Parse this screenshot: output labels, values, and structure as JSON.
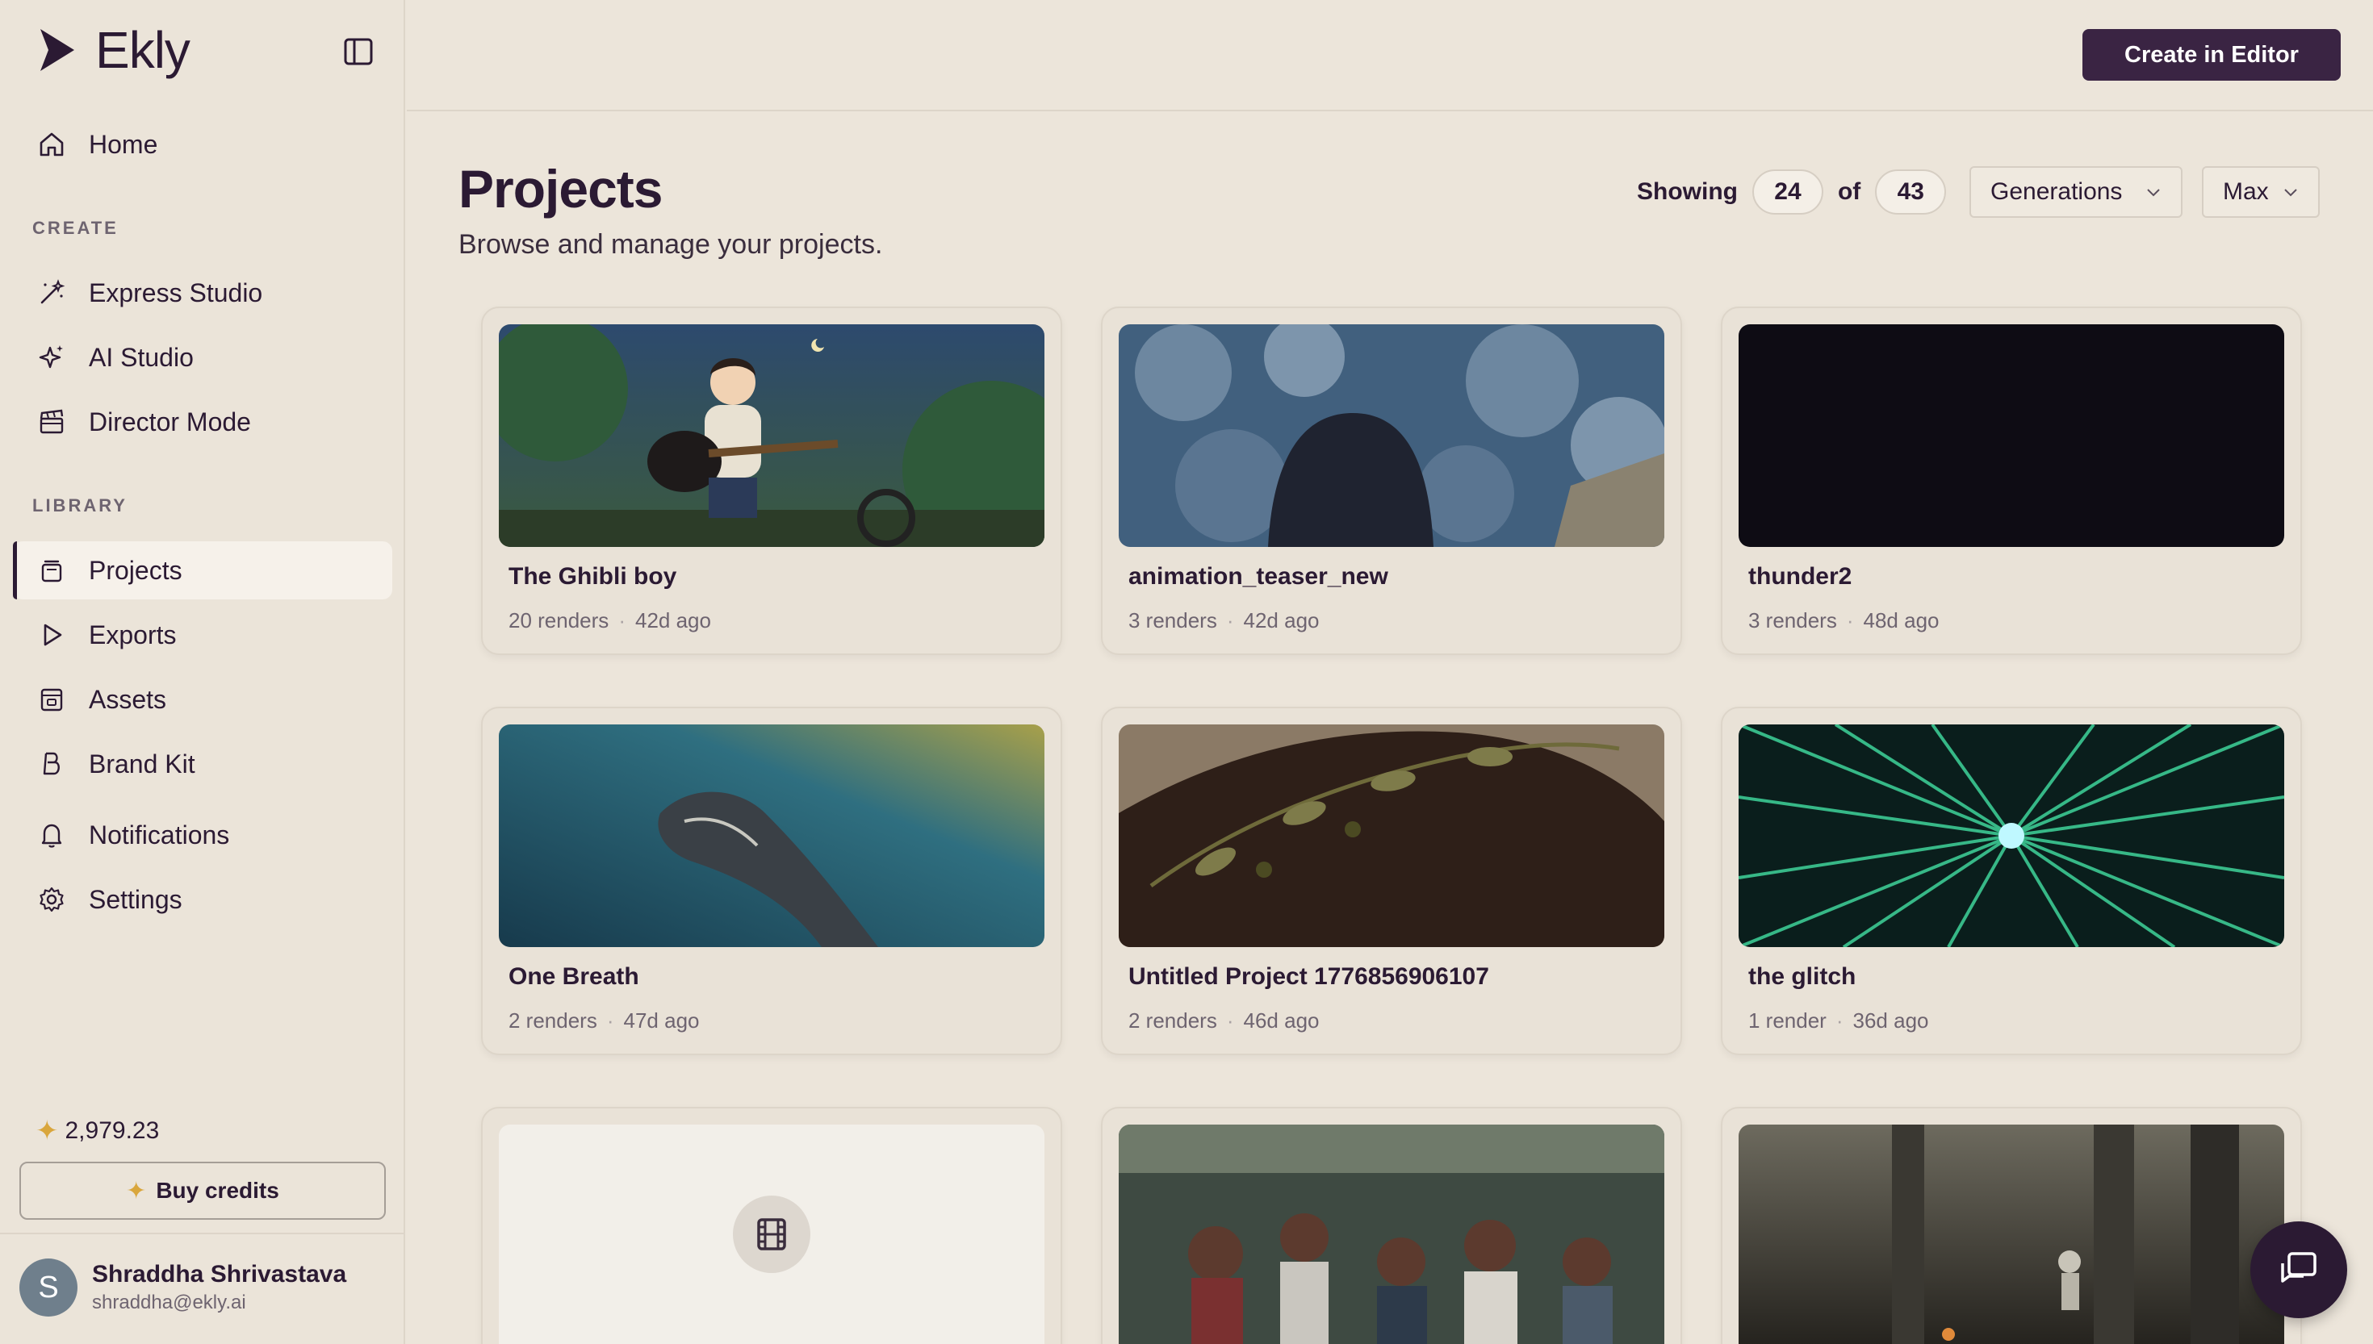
{
  "brand": {
    "name": "Ekly"
  },
  "sidebar": {
    "home": "Home",
    "create_label": "CREATE",
    "create_items": [
      "Express Studio",
      "AI Studio",
      "Director Mode"
    ],
    "library_label": "LIBRARY",
    "library_items": [
      "Projects",
      "Exports",
      "Assets",
      "Brand Kit"
    ],
    "notifications": "Notifications",
    "settings": "Settings",
    "credits": "2,979.23",
    "buy_credits": "Buy credits",
    "user": {
      "initial": "S",
      "name": "Shraddha Shrivastava",
      "email": "shraddha@ekly.ai"
    }
  },
  "topbar": {
    "create_label": "Create in Editor"
  },
  "main": {
    "title": "Projects",
    "subtitle": "Browse and manage your projects.",
    "showing_label": "Showing",
    "showing_count": "24",
    "of_label": "of",
    "total": "43",
    "filter_value": "Generations",
    "sort_value": "Max"
  },
  "projects": [
    {
      "title": "The Ghibli boy",
      "renders": "20 renders",
      "age": "42d ago"
    },
    {
      "title": "animation_teaser_new",
      "renders": "3 renders",
      "age": "42d ago"
    },
    {
      "title": "thunder2",
      "renders": "3 renders",
      "age": "48d ago"
    },
    {
      "title": "One Breath",
      "renders": "2 renders",
      "age": "47d ago"
    },
    {
      "title": "Untitled Project 1776856906107",
      "renders": "2 renders",
      "age": "46d ago"
    },
    {
      "title": "the glitch",
      "renders": "1 render",
      "age": "36d ago"
    }
  ],
  "colors": {
    "accent": "#3a2443",
    "credit_star": "#d9a63c",
    "background": "#ece5da"
  }
}
